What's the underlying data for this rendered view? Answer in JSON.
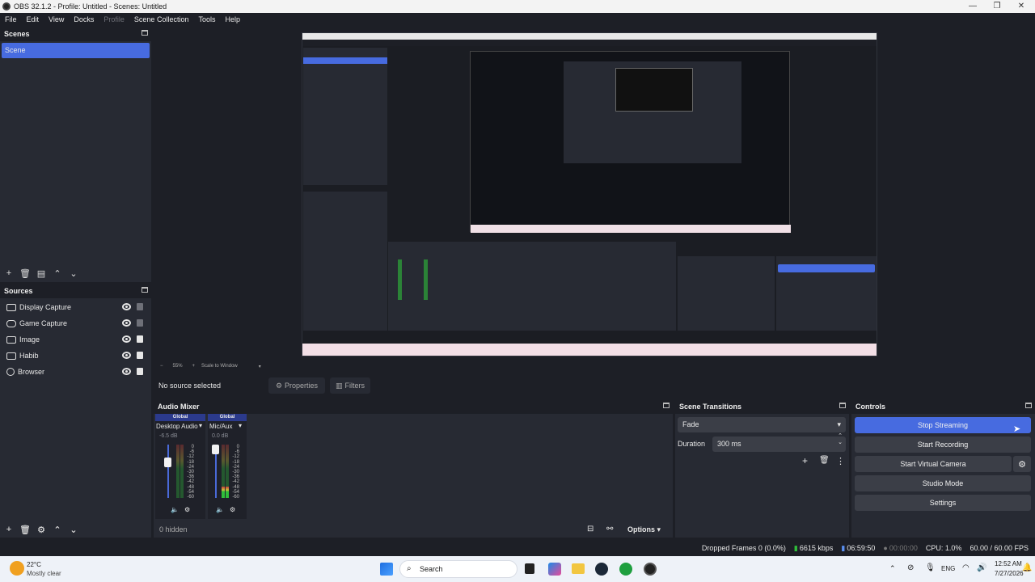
{
  "window": {
    "title": "OBS 32.1.2 - Profile: Untitled - Scenes: Untitled"
  },
  "menu": [
    "File",
    "Edit",
    "View",
    "Docks",
    "Profile",
    "Scene Collection",
    "Tools",
    "Help"
  ],
  "scenes": {
    "title": "Scenes",
    "items": [
      "Scene"
    ]
  },
  "sources": {
    "title": "Sources",
    "items": [
      {
        "name": "Display Capture",
        "icon": "monitor-icon",
        "locked": false
      },
      {
        "name": "Game Capture",
        "icon": "gamepad-icon",
        "locked": false
      },
      {
        "name": "Image",
        "icon": "image-icon",
        "locked": true
      },
      {
        "name": "Habib",
        "icon": "window-icon",
        "locked": true
      },
      {
        "name": "Browser",
        "icon": "globe-icon",
        "locked": true
      }
    ]
  },
  "preview_bar": {
    "zoom": "55%",
    "scale": "Scale to Window"
  },
  "context": {
    "no_source": "No source selected",
    "properties": "Properties",
    "filters": "Filters"
  },
  "mixer": {
    "title": "Audio Mixer",
    "hidden": "0 hidden",
    "options": "Options",
    "channels": [
      {
        "badge": "Global",
        "name": "Desktop Audio",
        "db": "-6.5 dB"
      },
      {
        "badge": "Global",
        "name": "Mic/Aux",
        "db": "0.0 dB"
      }
    ],
    "scale": [
      "0",
      "-6",
      "-12",
      "-18",
      "-24",
      "-30",
      "-36",
      "-42",
      "-48",
      "-54",
      "-60"
    ]
  },
  "transitions": {
    "title": "Scene Transitions",
    "selected": "Fade",
    "duration_label": "Duration",
    "duration": "300 ms"
  },
  "controls": {
    "title": "Controls",
    "stop_streaming": "Stop Streaming",
    "start_recording": "Start Recording",
    "start_virtual_camera": "Start Virtual Camera",
    "studio_mode": "Studio Mode",
    "settings": "Settings"
  },
  "status": {
    "dropped": "Dropped Frames 0 (0.0%)",
    "kbps": "6615 kbps",
    "stream_time": "06:59:50",
    "rec_time": "00:00:00",
    "cpu": "CPU: 1.0%",
    "fps": "60.00 / 60.00 FPS"
  },
  "taskbar": {
    "temp": "22°C",
    "weather": "Mostly clear",
    "search": "Search",
    "lang": "ENG",
    "time": "12:52 AM",
    "date": "7/27/2026"
  },
  "colors": {
    "accent": "#476be0",
    "panel": "#272a33",
    "bg": "#1d1f26"
  }
}
